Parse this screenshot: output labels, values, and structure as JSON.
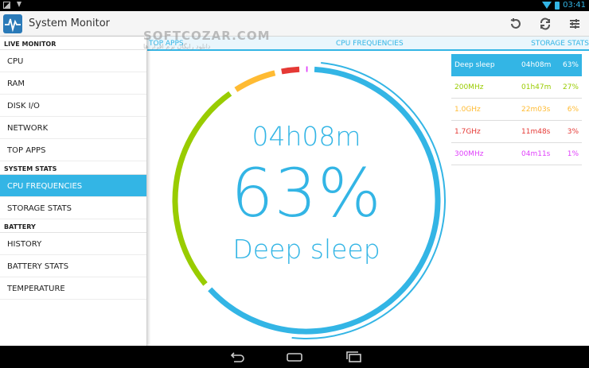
{
  "status_bar": {
    "time": "03:41"
  },
  "app": {
    "title": "System Monitor"
  },
  "toolbar": {
    "actions": [
      {
        "icon": "reset-icon"
      },
      {
        "icon": "refresh-icon"
      },
      {
        "icon": "settings-sliders-icon"
      }
    ]
  },
  "sidebar": {
    "sections": [
      {
        "header": "LIVE MONITOR",
        "items": [
          "CPU",
          "RAM",
          "DISK I/O",
          "NETWORK",
          "TOP APPS"
        ]
      },
      {
        "header": "SYSTEM STATS",
        "items": [
          "CPU FREQUENCIES",
          "STORAGE STATS"
        ]
      },
      {
        "header": "BATTERY",
        "items": [
          "HISTORY",
          "BATTERY STATS",
          "TEMPERATURE"
        ]
      }
    ],
    "active": "CPU FREQUENCIES"
  },
  "tabs": {
    "left": "TOP APPS",
    "center": "CPU FREQUENCIES",
    "right": "STORAGE STATS"
  },
  "summary": {
    "time": "04h08m",
    "percent": "63%",
    "state": "Deep sleep"
  },
  "frequencies": [
    {
      "label": "Deep sleep",
      "time": "04h08m",
      "percent": "63%",
      "value": 63,
      "color": "#33b5e5"
    },
    {
      "label": "200MHz",
      "time": "01h47m",
      "percent": "27%",
      "value": 27,
      "color": "#99cc00"
    },
    {
      "label": "1.0GHz",
      "time": "22m03s",
      "percent": "6%",
      "value": 6,
      "color": "#ffbb33"
    },
    {
      "label": "1.7GHz",
      "time": "11m48s",
      "percent": "3%",
      "value": 3,
      "color": "#e53935"
    },
    {
      "label": "300MHz",
      "time": "04m11s",
      "percent": "1%",
      "value": 1,
      "color": "#e040fb"
    }
  ],
  "watermark": {
    "title": "SOFTCOZAR.COM",
    "subtitle": "دانلود رایگان نرم افزار ها"
  }
}
